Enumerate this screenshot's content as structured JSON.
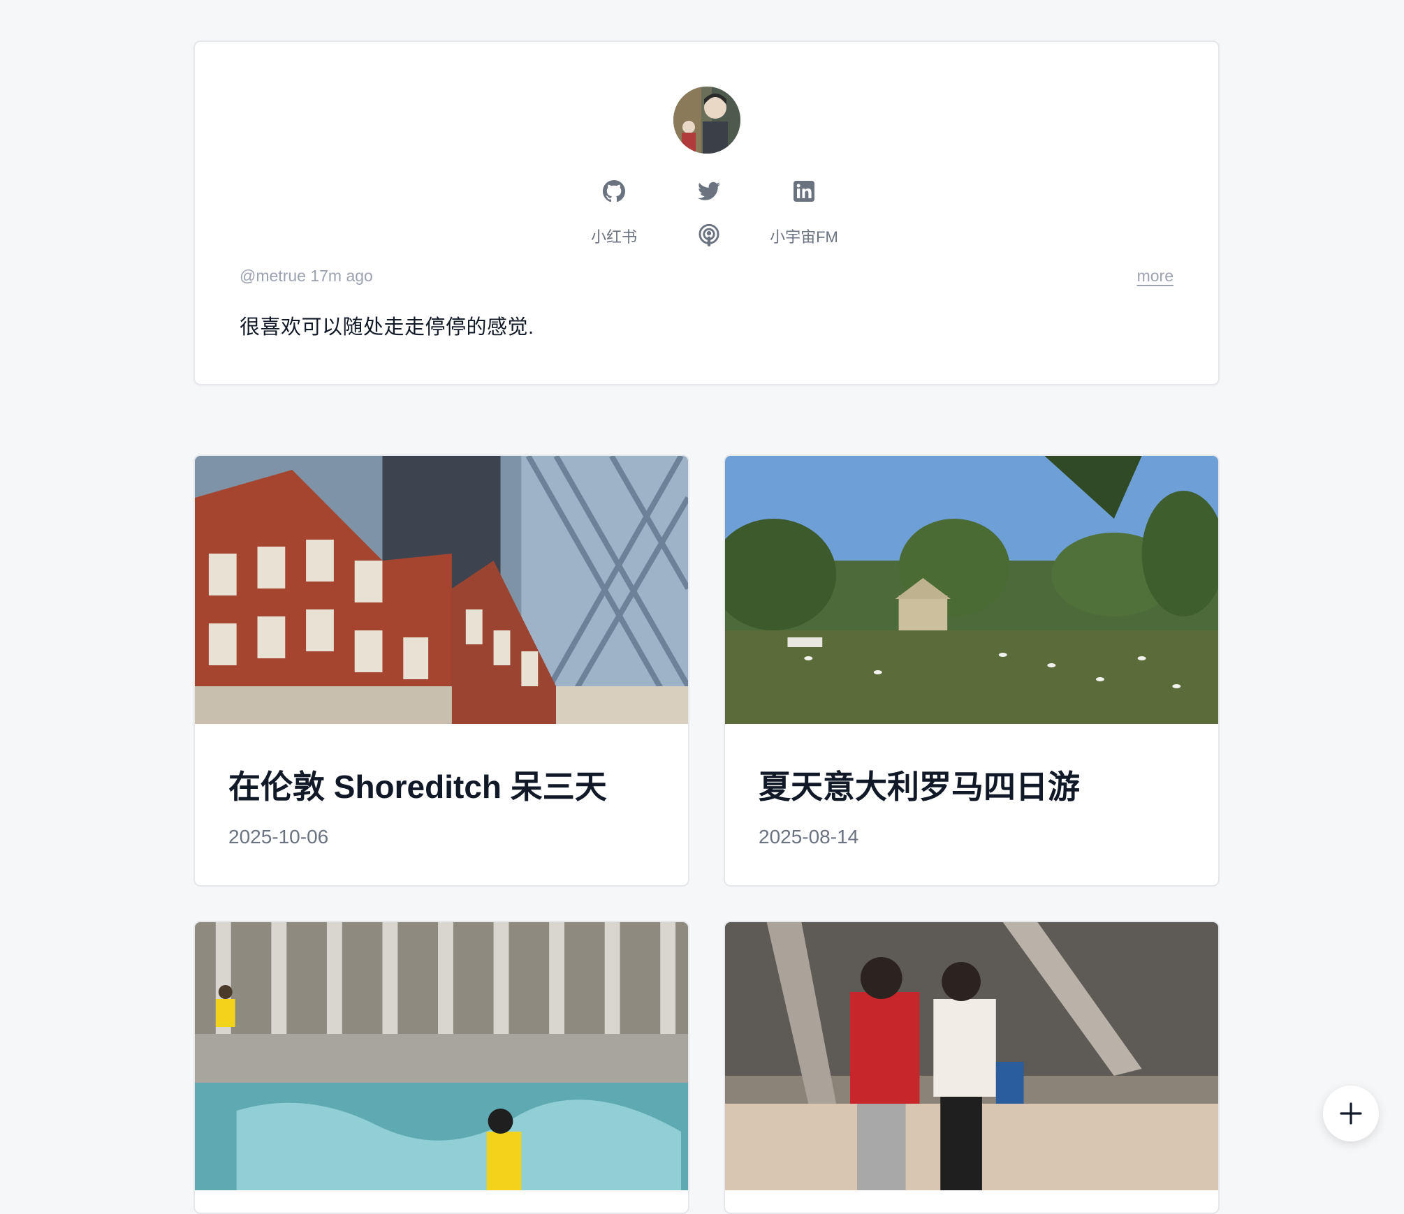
{
  "profile": {
    "avatar_alt": "avatar",
    "links": {
      "github": "github-icon",
      "twitter": "twitter-icon",
      "linkedin": "linkedin-icon",
      "xiaohongshu_label": "小红书",
      "podcast": "podcast-icon",
      "fm_label": "小宇宙FM"
    },
    "handle_time": "@metrue 17m ago",
    "more_label": "more",
    "status_text": "很喜欢可以随处走走停停的感觉."
  },
  "posts": [
    {
      "title": "在伦敦 Shoreditch 呆三天",
      "date": "2025-10-06"
    },
    {
      "title": "夏天意大利罗马四日游",
      "date": "2025-08-14"
    },
    {
      "title": "",
      "date": ""
    },
    {
      "title": "",
      "date": ""
    }
  ],
  "fab": {
    "icon": "plus-icon"
  },
  "colors": {
    "accent": "#111827",
    "muted": "#6b7280",
    "background": "#f6f7f9"
  }
}
